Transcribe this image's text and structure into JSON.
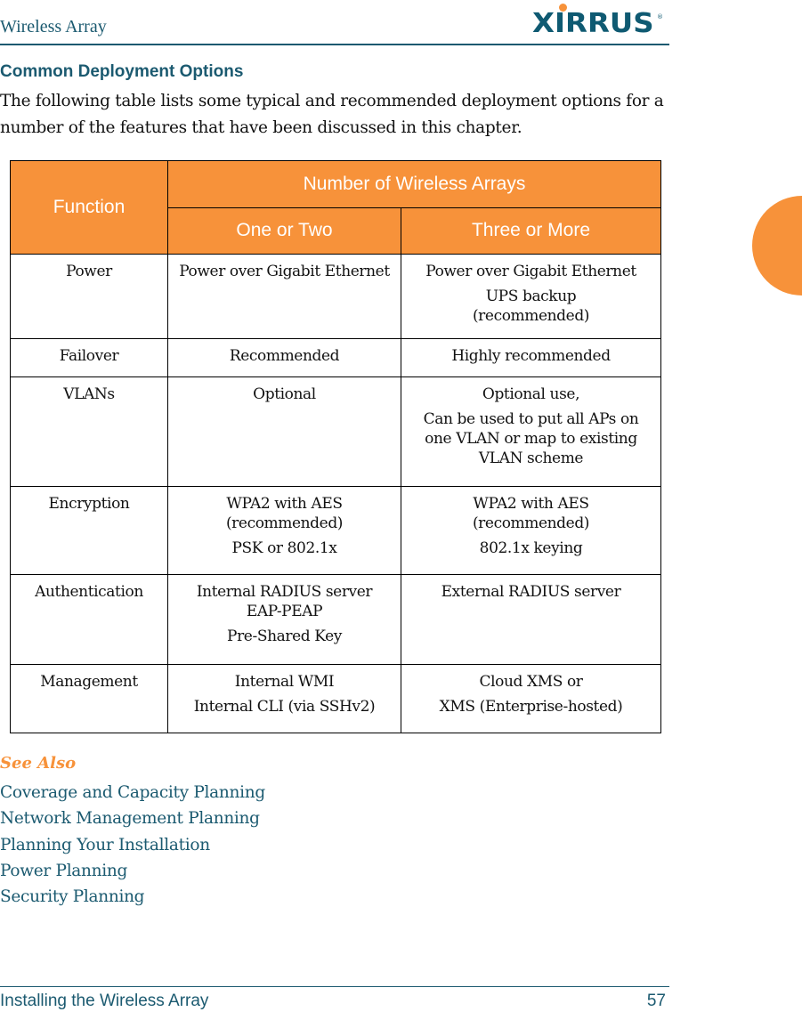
{
  "header": {
    "title": "Wireless Array",
    "logo_text": "XIRRUS",
    "logo_reg": "®"
  },
  "colors": {
    "brand_teal": "#1b5a70",
    "accent_orange": "#f7923a"
  },
  "section": {
    "heading": "Common Deployment Options",
    "intro": "The following table lists some typical and recommended deployment options for a number of the features that have been discussed in this chapter."
  },
  "table": {
    "header": {
      "function": "Function",
      "group": "Number of Wireless Arrays",
      "col_one_or_two": "One or Two",
      "col_three_or_more": "Three or More"
    },
    "rows": [
      {
        "function": "Power",
        "one_or_two": [
          "Power over Gigabit Ethernet"
        ],
        "three_or_more": [
          "Power over Gigabit Ethernet",
          "UPS backup (recommended)"
        ]
      },
      {
        "function": "Failover",
        "one_or_two": [
          "Recommended"
        ],
        "three_or_more": [
          "Highly recommended"
        ]
      },
      {
        "function": "VLANs",
        "one_or_two": [
          "Optional"
        ],
        "three_or_more": [
          "Optional use,",
          "Can be used to put all APs on one VLAN or map to existing VLAN scheme"
        ]
      },
      {
        "function": "Encryption",
        "one_or_two": [
          "WPA2 with AES (recommended)",
          "PSK or 802.1x"
        ],
        "three_or_more": [
          "WPA2 with AES (recommended)",
          "802.1x keying"
        ]
      },
      {
        "function": "Authentication",
        "one_or_two": [
          "Internal RADIUS server EAP-PEAP",
          "Pre-Shared Key"
        ],
        "three_or_more": [
          "External RADIUS server"
        ]
      },
      {
        "function": "Management",
        "one_or_two": [
          "Internal WMI",
          "Internal CLI (via SSHv2)"
        ],
        "three_or_more": [
          "Cloud XMS or",
          "XMS (Enterprise-hosted)"
        ]
      }
    ]
  },
  "see_also": {
    "heading": "See Also",
    "links": [
      "Coverage and Capacity Planning",
      "Network Management Planning",
      "Planning Your Installation",
      "Power Planning",
      "Security Planning"
    ]
  },
  "footer": {
    "chapter": "Installing the Wireless Array",
    "page_number": "57"
  }
}
